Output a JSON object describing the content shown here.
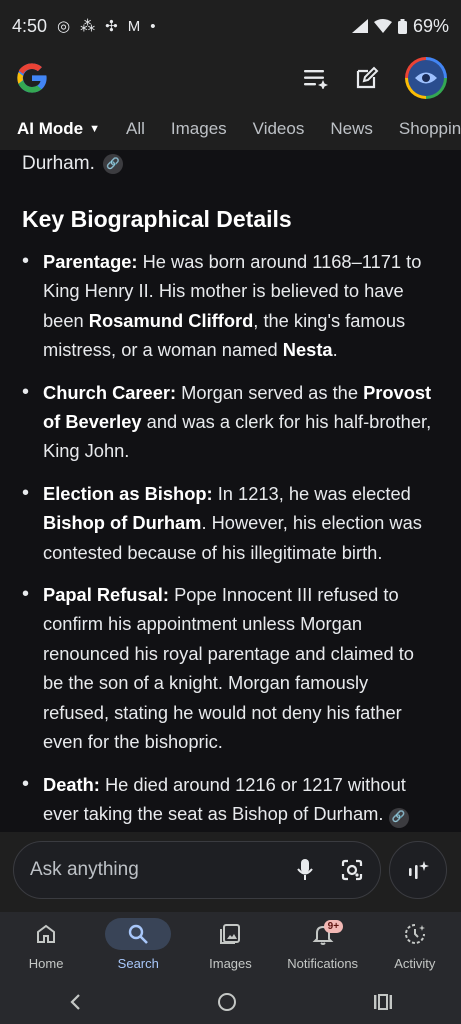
{
  "status": {
    "time": "4:50",
    "battery": "69%"
  },
  "tabs": {
    "active": "AI Mode",
    "items": [
      "All",
      "Images",
      "Videos",
      "News",
      "Shopping"
    ]
  },
  "content": {
    "lead": "Durham.",
    "heading": "Key Biographical Details",
    "items": [
      {
        "label": "Parentage:",
        "t1": " He was born around 1168–1171 to King Henry II. His mother is believed to have been ",
        "b1": "Rosamund Clifford",
        "t2": ", the king's famous mistress, or a woman named ",
        "b2": "Nesta",
        "t3": "."
      },
      {
        "label": "Church Career:",
        "t1": " Morgan served as the ",
        "b1": "Provost of Beverley",
        "t2": " and was a clerk for his half-brother, King John."
      },
      {
        "label": "Election as Bishop:",
        "t1": " In 1213, he was elected ",
        "b1": "Bishop of Durham",
        "t2": ". However, his election was contested because of his illegitimate birth."
      },
      {
        "label": "Papal Refusal:",
        "t1": " Pope Innocent III refused to confirm his appointment unless Morgan renounced his royal parentage and claimed to be the son of a knight. Morgan famously refused, stating he would not deny his father even for the bishopric."
      },
      {
        "label": "Death:",
        "t1": " He died around 1216 or 1217 without ever taking the seat as Bishop of Durham."
      }
    ]
  },
  "search": {
    "placeholder": "Ask anything"
  },
  "bottom_nav": {
    "home": "Home",
    "search": "Search",
    "images": "Images",
    "notifications": "Notifications",
    "notifications_badge": "9+",
    "activity": "Activity"
  },
  "colors": {
    "accent": "#a8c7fa",
    "badge": "#f2b8b5",
    "background": "#111114"
  },
  "icons": [
    "google-logo",
    "threads-icon",
    "slack-icon",
    "gmail-icon",
    "signal-icon",
    "wifi-icon",
    "battery-icon",
    "history-icon",
    "edit-icon",
    "link-icon",
    "mic-icon",
    "lens-icon",
    "sparkle-icon",
    "home-icon",
    "search-icon",
    "images-icon",
    "bell-icon",
    "activity-icon"
  ]
}
